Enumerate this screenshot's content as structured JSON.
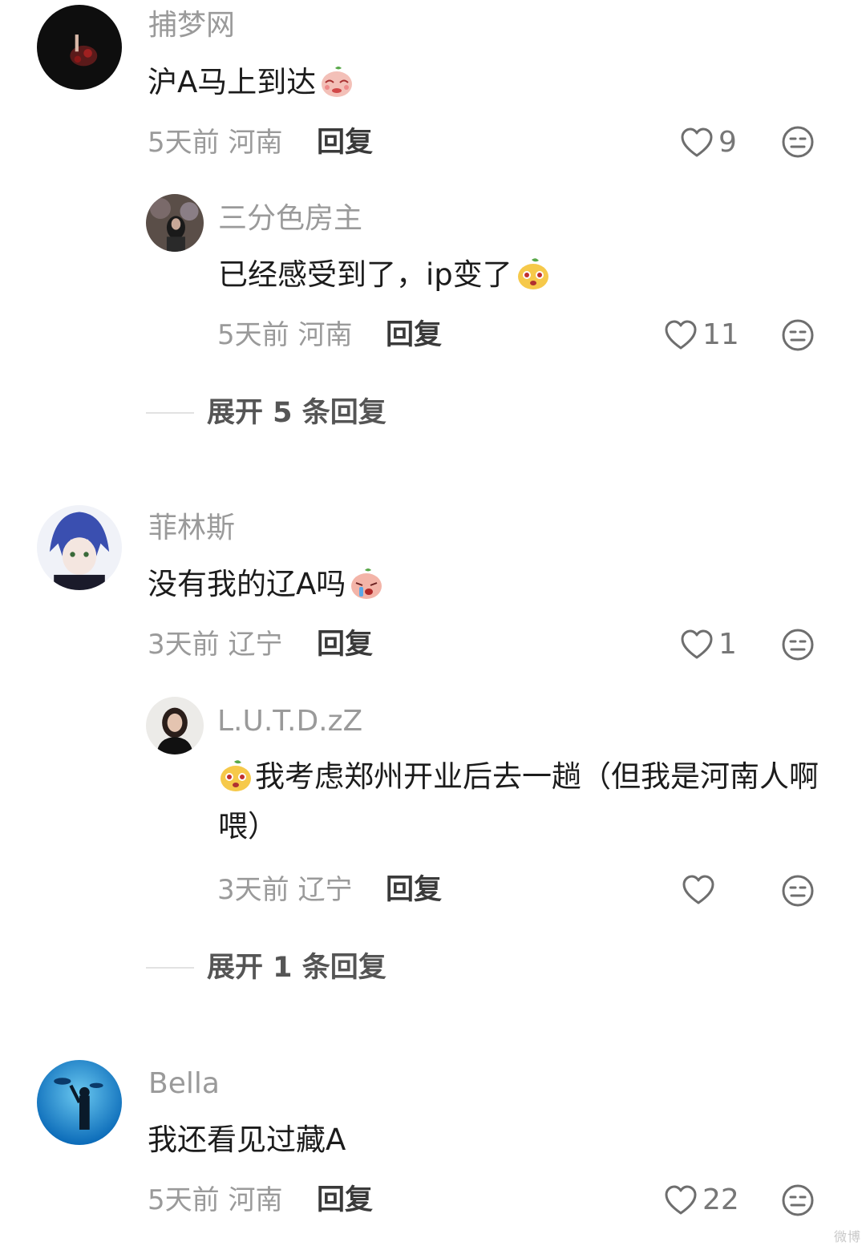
{
  "comments": [
    {
      "username": "捕梦网",
      "text": "沪A马上到达",
      "time": "5天前",
      "location": "河南",
      "reply_label": "回复",
      "likes": "9",
      "replies": [
        {
          "username": "三分色房主",
          "text": "已经感受到了，ip变了",
          "time": "5天前",
          "location": "河南",
          "reply_label": "回复",
          "likes": "11"
        }
      ],
      "expand_label": "展开 5 条回复"
    },
    {
      "username": "菲林斯",
      "text": "没有我的辽A吗",
      "time": "3天前",
      "location": "辽宁",
      "reply_label": "回复",
      "likes": "1",
      "replies": [
        {
          "username": "L.U.T.D.zZ",
          "text": "我考虑郑州开业后去一趟（但我是河南人啊喂）",
          "time": "3天前",
          "location": "辽宁",
          "reply_label": "回复",
          "likes": ""
        }
      ],
      "expand_label": "展开 1 条回复"
    },
    {
      "username": "Bella",
      "text": "我还看见过藏A",
      "time": "5天前",
      "location": "河南",
      "reply_label": "回复",
      "likes": "22"
    }
  ],
  "icons": {
    "like": "heart-outline-icon",
    "dislike": "meh-face-icon",
    "emoji_1": "shy-sticker-icon",
    "emoji_2": "yellow-face-sticker-icon",
    "emoji_3": "crying-sticker-icon"
  },
  "colors": {
    "username": "#9a9a9a",
    "text": "#1c1c1c",
    "meta": "#9a9a9a",
    "icon": "#6e6e6e"
  },
  "watermark": "微博"
}
